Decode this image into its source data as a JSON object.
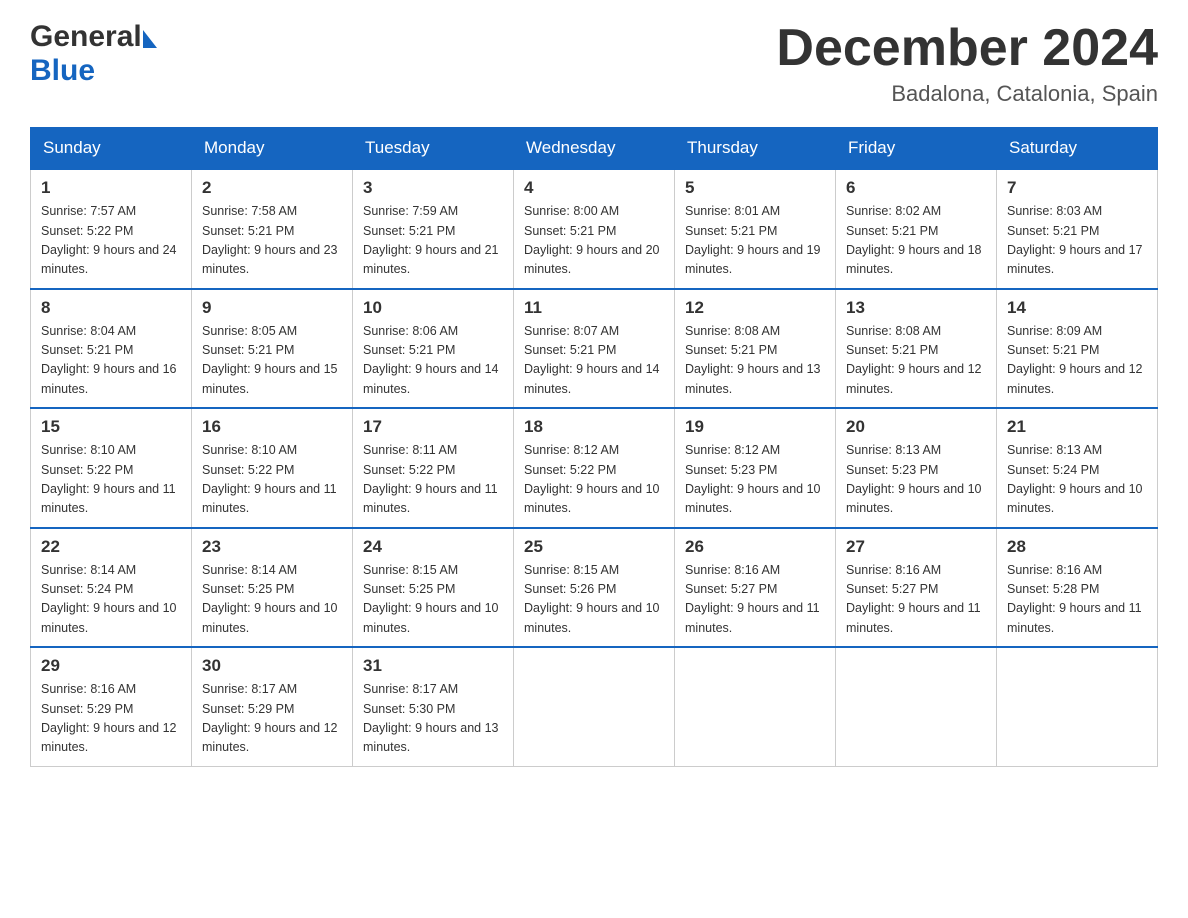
{
  "header": {
    "logo_general": "General",
    "logo_blue": "Blue",
    "month_title": "December 2024",
    "location": "Badalona, Catalonia, Spain"
  },
  "days_of_week": [
    "Sunday",
    "Monday",
    "Tuesday",
    "Wednesday",
    "Thursday",
    "Friday",
    "Saturday"
  ],
  "weeks": [
    [
      {
        "day": "1",
        "sunrise": "Sunrise: 7:57 AM",
        "sunset": "Sunset: 5:22 PM",
        "daylight": "Daylight: 9 hours and 24 minutes."
      },
      {
        "day": "2",
        "sunrise": "Sunrise: 7:58 AM",
        "sunset": "Sunset: 5:21 PM",
        "daylight": "Daylight: 9 hours and 23 minutes."
      },
      {
        "day": "3",
        "sunrise": "Sunrise: 7:59 AM",
        "sunset": "Sunset: 5:21 PM",
        "daylight": "Daylight: 9 hours and 21 minutes."
      },
      {
        "day": "4",
        "sunrise": "Sunrise: 8:00 AM",
        "sunset": "Sunset: 5:21 PM",
        "daylight": "Daylight: 9 hours and 20 minutes."
      },
      {
        "day": "5",
        "sunrise": "Sunrise: 8:01 AM",
        "sunset": "Sunset: 5:21 PM",
        "daylight": "Daylight: 9 hours and 19 minutes."
      },
      {
        "day": "6",
        "sunrise": "Sunrise: 8:02 AM",
        "sunset": "Sunset: 5:21 PM",
        "daylight": "Daylight: 9 hours and 18 minutes."
      },
      {
        "day": "7",
        "sunrise": "Sunrise: 8:03 AM",
        "sunset": "Sunset: 5:21 PM",
        "daylight": "Daylight: 9 hours and 17 minutes."
      }
    ],
    [
      {
        "day": "8",
        "sunrise": "Sunrise: 8:04 AM",
        "sunset": "Sunset: 5:21 PM",
        "daylight": "Daylight: 9 hours and 16 minutes."
      },
      {
        "day": "9",
        "sunrise": "Sunrise: 8:05 AM",
        "sunset": "Sunset: 5:21 PM",
        "daylight": "Daylight: 9 hours and 15 minutes."
      },
      {
        "day": "10",
        "sunrise": "Sunrise: 8:06 AM",
        "sunset": "Sunset: 5:21 PM",
        "daylight": "Daylight: 9 hours and 14 minutes."
      },
      {
        "day": "11",
        "sunrise": "Sunrise: 8:07 AM",
        "sunset": "Sunset: 5:21 PM",
        "daylight": "Daylight: 9 hours and 14 minutes."
      },
      {
        "day": "12",
        "sunrise": "Sunrise: 8:08 AM",
        "sunset": "Sunset: 5:21 PM",
        "daylight": "Daylight: 9 hours and 13 minutes."
      },
      {
        "day": "13",
        "sunrise": "Sunrise: 8:08 AM",
        "sunset": "Sunset: 5:21 PM",
        "daylight": "Daylight: 9 hours and 12 minutes."
      },
      {
        "day": "14",
        "sunrise": "Sunrise: 8:09 AM",
        "sunset": "Sunset: 5:21 PM",
        "daylight": "Daylight: 9 hours and 12 minutes."
      }
    ],
    [
      {
        "day": "15",
        "sunrise": "Sunrise: 8:10 AM",
        "sunset": "Sunset: 5:22 PM",
        "daylight": "Daylight: 9 hours and 11 minutes."
      },
      {
        "day": "16",
        "sunrise": "Sunrise: 8:10 AM",
        "sunset": "Sunset: 5:22 PM",
        "daylight": "Daylight: 9 hours and 11 minutes."
      },
      {
        "day": "17",
        "sunrise": "Sunrise: 8:11 AM",
        "sunset": "Sunset: 5:22 PM",
        "daylight": "Daylight: 9 hours and 11 minutes."
      },
      {
        "day": "18",
        "sunrise": "Sunrise: 8:12 AM",
        "sunset": "Sunset: 5:22 PM",
        "daylight": "Daylight: 9 hours and 10 minutes."
      },
      {
        "day": "19",
        "sunrise": "Sunrise: 8:12 AM",
        "sunset": "Sunset: 5:23 PM",
        "daylight": "Daylight: 9 hours and 10 minutes."
      },
      {
        "day": "20",
        "sunrise": "Sunrise: 8:13 AM",
        "sunset": "Sunset: 5:23 PM",
        "daylight": "Daylight: 9 hours and 10 minutes."
      },
      {
        "day": "21",
        "sunrise": "Sunrise: 8:13 AM",
        "sunset": "Sunset: 5:24 PM",
        "daylight": "Daylight: 9 hours and 10 minutes."
      }
    ],
    [
      {
        "day": "22",
        "sunrise": "Sunrise: 8:14 AM",
        "sunset": "Sunset: 5:24 PM",
        "daylight": "Daylight: 9 hours and 10 minutes."
      },
      {
        "day": "23",
        "sunrise": "Sunrise: 8:14 AM",
        "sunset": "Sunset: 5:25 PM",
        "daylight": "Daylight: 9 hours and 10 minutes."
      },
      {
        "day": "24",
        "sunrise": "Sunrise: 8:15 AM",
        "sunset": "Sunset: 5:25 PM",
        "daylight": "Daylight: 9 hours and 10 minutes."
      },
      {
        "day": "25",
        "sunrise": "Sunrise: 8:15 AM",
        "sunset": "Sunset: 5:26 PM",
        "daylight": "Daylight: 9 hours and 10 minutes."
      },
      {
        "day": "26",
        "sunrise": "Sunrise: 8:16 AM",
        "sunset": "Sunset: 5:27 PM",
        "daylight": "Daylight: 9 hours and 11 minutes."
      },
      {
        "day": "27",
        "sunrise": "Sunrise: 8:16 AM",
        "sunset": "Sunset: 5:27 PM",
        "daylight": "Daylight: 9 hours and 11 minutes."
      },
      {
        "day": "28",
        "sunrise": "Sunrise: 8:16 AM",
        "sunset": "Sunset: 5:28 PM",
        "daylight": "Daylight: 9 hours and 11 minutes."
      }
    ],
    [
      {
        "day": "29",
        "sunrise": "Sunrise: 8:16 AM",
        "sunset": "Sunset: 5:29 PM",
        "daylight": "Daylight: 9 hours and 12 minutes."
      },
      {
        "day": "30",
        "sunrise": "Sunrise: 8:17 AM",
        "sunset": "Sunset: 5:29 PM",
        "daylight": "Daylight: 9 hours and 12 minutes."
      },
      {
        "day": "31",
        "sunrise": "Sunrise: 8:17 AM",
        "sunset": "Sunset: 5:30 PM",
        "daylight": "Daylight: 9 hours and 13 minutes."
      },
      null,
      null,
      null,
      null
    ]
  ]
}
